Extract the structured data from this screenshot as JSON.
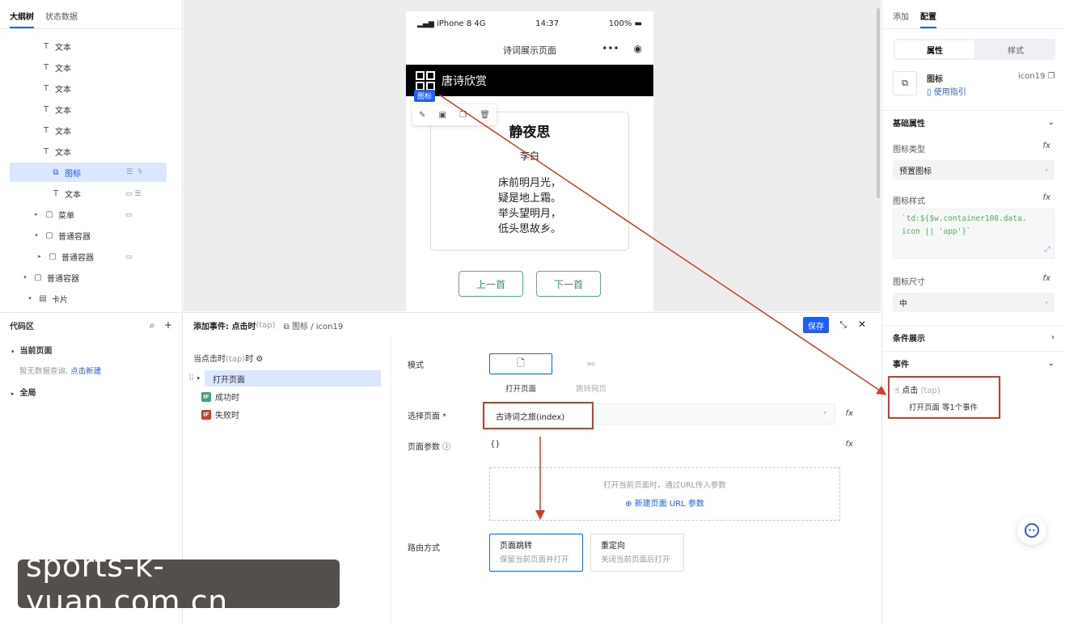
{
  "left_panel": {
    "tabs": [
      "大纲树",
      "状态数据"
    ],
    "tree": [
      {
        "label": "文本",
        "icon": "text-icon"
      },
      {
        "label": "文本",
        "icon": "text-icon"
      },
      {
        "label": "文本",
        "icon": "text-icon"
      },
      {
        "label": "文本",
        "icon": "text-icon"
      },
      {
        "label": "文本",
        "icon": "text-icon"
      },
      {
        "label": "文本",
        "icon": "text-icon"
      },
      {
        "label": "图标",
        "icon": "icon-component-icon",
        "selected": true
      },
      {
        "label": "文本",
        "icon": "text-icon"
      },
      {
        "label": "菜单",
        "icon": "container-icon"
      },
      {
        "label": "普通容器",
        "icon": "container-icon"
      },
      {
        "label": "普通容器",
        "icon": "container-icon"
      },
      {
        "label": "普通容器",
        "icon": "container-icon"
      },
      {
        "label": "卡片",
        "icon": "card-icon"
      }
    ]
  },
  "code_panel": {
    "title": "代码区",
    "current_page": "当前页面",
    "empty_text": "暂无数据查询,",
    "create_link": "点击新建",
    "global": "全局"
  },
  "phone": {
    "carrier": "iPhone 8  4G",
    "time": "14:37",
    "battery": "100%",
    "nav_title": "诗词展示页面",
    "header_title": "唐诗欣赏",
    "icon_badge": "图标",
    "poem": {
      "title": "静夜思",
      "author": "李白",
      "lines": [
        "床前明月光，",
        "疑是地上霜。",
        "举头望明月，",
        "低头思故乡。"
      ]
    },
    "prev_button": "上一首",
    "next_button": "下一首"
  },
  "right_panel": {
    "tabs": [
      "添加",
      "配置"
    ],
    "segments": [
      "属性",
      "样式"
    ],
    "component_name": "图标",
    "guide_link": "使用指引",
    "component_id": "icon19",
    "section_basic": "基础属性",
    "icon_type_label": "图标类型",
    "icon_type_value": "预置图标",
    "icon_style_label": "图标样式",
    "icon_style_code_1": "`td:${$w.container108.data.",
    "icon_style_code_2": "icon || 'app'}`",
    "icon_size_label": "图标尺寸",
    "icon_size_value": "中",
    "section_condition": "条件展示",
    "section_events": "事件",
    "event_name": "点击",
    "event_tap": "(tap)",
    "event_summary": "打开页面 等1个事件",
    "fx": "fx"
  },
  "event_editor": {
    "title": "添加事件: 点击时",
    "title_tap": "(tap)",
    "breadcrumb": "图标 / icon19",
    "save": "保存",
    "trigger_label": "当点击时",
    "trigger_tap": "(tap)",
    "trigger_suffix": "时",
    "action": "打开页面",
    "success": "成功时",
    "failure": "失败时",
    "if_label": "IF",
    "mode_label": "模式",
    "mode_open_page": "打开页面",
    "mode_jump_web": "跳转网页",
    "select_page_label": "选择页面 *",
    "select_page_value": "古诗词之旅(index)",
    "page_params_label": "页面参数",
    "page_params_value": "{}",
    "params_hint": "打开当前页面时，通过URL传入参数",
    "new_param": "新建页面 URL 参数",
    "route_label": "路由方式",
    "route_jump": "页面跳转",
    "route_jump_desc": "保留当前页面并打开",
    "route_redirect": "重定向",
    "route_redirect_desc": "关闭当前页面后打开"
  },
  "watermark": "sports-k-yuan.com.cn",
  "colors": {
    "accent": "#1e5eff",
    "annotation": "#d23a2a",
    "teal": "#3a8a80"
  }
}
